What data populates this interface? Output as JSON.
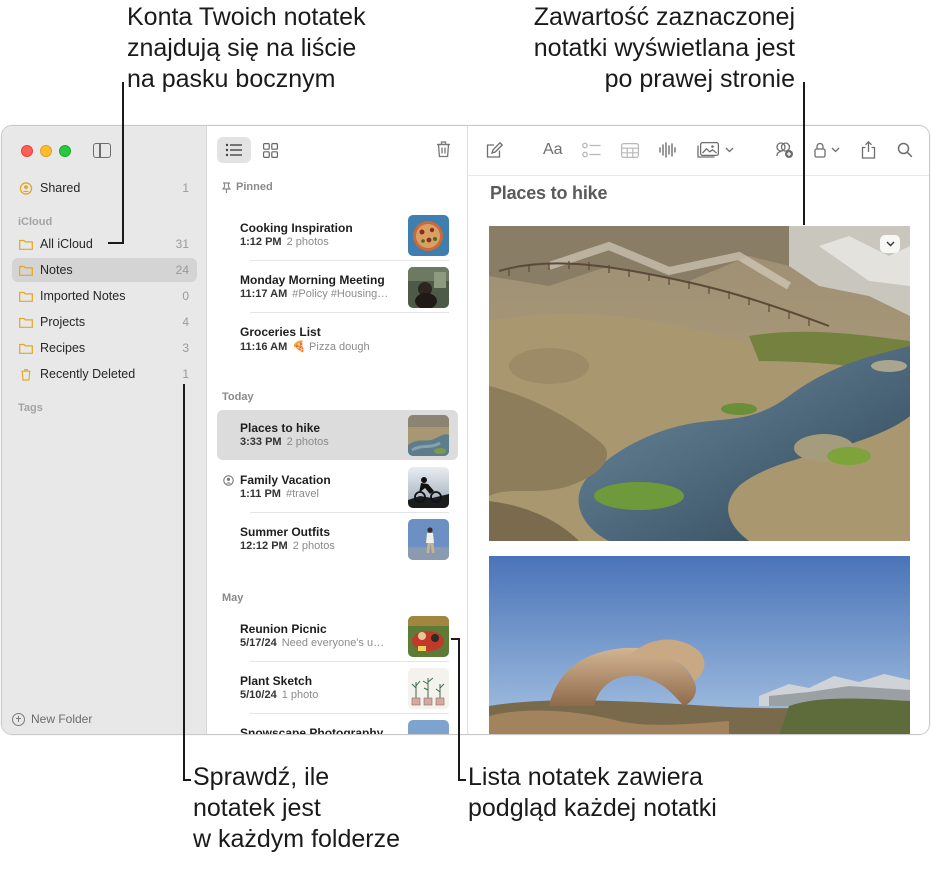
{
  "callouts": {
    "top_left": [
      "Konta Twoich notatek",
      "znajdują się na liście",
      "na pasku bocznym"
    ],
    "top_right": [
      "Zawartość zaznaczonej",
      "notatki wyświetlana jest",
      "po prawej stronie"
    ],
    "bottom_left": [
      "Sprawdź, ile",
      "notatek jest",
      "w każdym folderze"
    ],
    "bottom_right": [
      "Lista notatek zawiera",
      "podgląd każdej notatki"
    ]
  },
  "sidebar": {
    "shared": {
      "label": "Shared",
      "count": "1"
    },
    "section_icloud": "iCloud",
    "folders": [
      {
        "label": "All iCloud",
        "count": "31"
      },
      {
        "label": "Notes",
        "count": "24"
      },
      {
        "label": "Imported Notes",
        "count": "0"
      },
      {
        "label": "Projects",
        "count": "4"
      },
      {
        "label": "Recipes",
        "count": "3"
      },
      {
        "label": "Recently Deleted",
        "count": "1"
      }
    ],
    "section_tags": "Tags",
    "new_folder": "New Folder"
  },
  "list": {
    "groups": {
      "pinned": "Pinned",
      "today": "Today",
      "may": "May"
    },
    "notes": [
      {
        "title": "Cooking Inspiration",
        "time": "1:12 PM",
        "preview": "2 photos"
      },
      {
        "title": "Monday Morning Meeting",
        "time": "11:17 AM",
        "preview": "#Policy #Housing…"
      },
      {
        "title": "Groceries List",
        "time": "11:16 AM",
        "preview": "🍕 Pizza dough"
      },
      {
        "title": "Places to hike",
        "time": "3:33 PM",
        "preview": "2 photos"
      },
      {
        "title": "Family Vacation",
        "time": "1:11 PM",
        "preview": "#travel"
      },
      {
        "title": "Summer Outfits",
        "time": "12:12 PM",
        "preview": "2 photos"
      },
      {
        "title": "Reunion Picnic",
        "time": "5/17/24",
        "preview": "Need everyone's u…"
      },
      {
        "title": "Plant Sketch",
        "time": "5/10/24",
        "preview": "1 photo"
      },
      {
        "title": "Snowscape Photography",
        "time": "",
        "preview": ""
      }
    ]
  },
  "content": {
    "format_label": "Aa",
    "note_title": "Places to hike"
  },
  "colors": {
    "accent": "#e3a81b",
    "selected": "#dcdcdc",
    "sidebar_bg": "#e8e8e8"
  }
}
